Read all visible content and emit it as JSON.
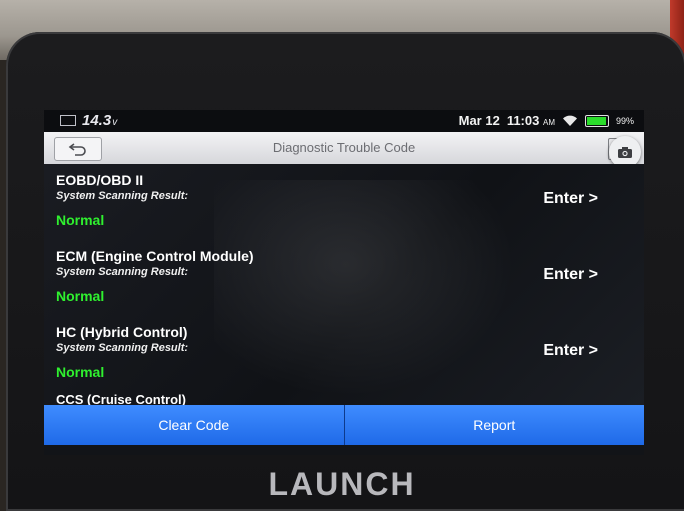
{
  "status_bar": {
    "voltage": "14.3",
    "voltage_unit": "v",
    "date": "Mar 12",
    "time": "11:03",
    "ampm": "AM",
    "battery_pct": "99%"
  },
  "header": {
    "title": "Diagnostic Trouble Code"
  },
  "list": {
    "items": [
      {
        "name": "EOBD/OBD II",
        "subtitle": "System Scanning Result:",
        "status": "Normal",
        "action": "Enter >"
      },
      {
        "name": "ECM (Engine Control Module)",
        "subtitle": "System Scanning Result:",
        "status": "Normal",
        "action": "Enter >"
      },
      {
        "name": "HC (Hybrid Control)",
        "subtitle": "System Scanning Result:",
        "status": "Normal",
        "action": "Enter >"
      }
    ],
    "partial_item": "CCS (Cruise Control)"
  },
  "buttons": {
    "clear_code": "Clear Code",
    "report": "Report"
  },
  "device": {
    "brand": "LAUNCH"
  },
  "colors": {
    "status_normal": "#2ff02f",
    "button_blue": "#2a78f5",
    "battery_green": "#2bdc2b"
  },
  "icons": {
    "back": "back-arrow-icon",
    "camera": "camera-icon",
    "wifi": "wifi-icon",
    "battery": "battery-icon"
  }
}
